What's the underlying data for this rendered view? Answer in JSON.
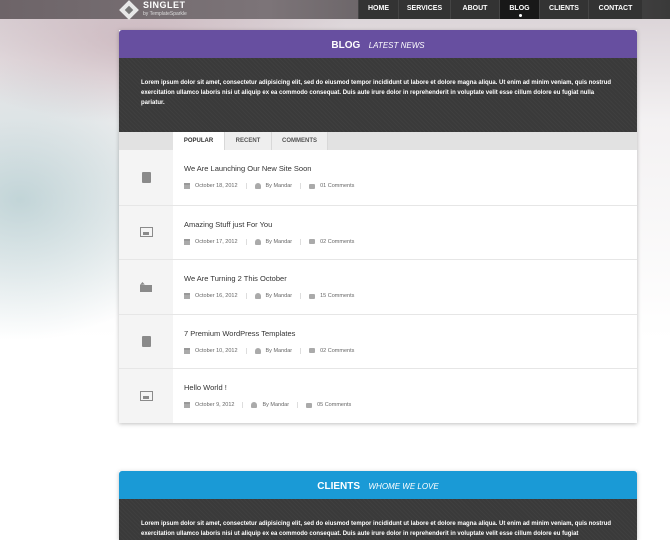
{
  "brand": {
    "name": "SINGLET",
    "tagline": "by TemplateSparkle"
  },
  "nav": [
    {
      "label": "HOME",
      "active": false
    },
    {
      "label": "SERVICES",
      "active": false
    },
    {
      "label": "ABOUT",
      "active": false
    },
    {
      "label": "BLOG",
      "active": true
    },
    {
      "label": "CLIENTS",
      "active": false
    },
    {
      "label": "CONTACT",
      "active": false
    }
  ],
  "blog": {
    "title": "BLOG",
    "subtitle": "LATEST NEWS",
    "intro": "Lorem ipsum dolor sit amet, consectetur adipisicing elit, sed do eiusmod tempor incididunt ut labore et dolore magna aliqua. Ut enim ad minim veniam, quis nostrud exercitation ullamco laboris nisi ut aliquip ex ea commodo consequat. Duis aute irure dolor in reprehenderit in voluptate velit esse cillum dolore eu fugiat nulla pariatur.",
    "accent": "#674fa0",
    "tabs": [
      {
        "label": "POPULAR",
        "active": true
      },
      {
        "label": "RECENT",
        "active": false
      },
      {
        "label": "COMMENTS",
        "active": false
      }
    ],
    "posts": [
      {
        "icon": "document-icon",
        "title": "We Are Launching Our New Site Soon",
        "date": "October 18, 2012",
        "author": "By Mandar",
        "comments": "01 Comments"
      },
      {
        "icon": "image-icon",
        "title": "Amazing Stuff just For You",
        "date": "October 17, 2012",
        "author": "By Mandar",
        "comments": "02 Comments"
      },
      {
        "icon": "video-icon",
        "title": "We Are Turning 2 This October",
        "date": "October 16, 2012",
        "author": "By Mandar",
        "comments": "15 Comments"
      },
      {
        "icon": "document-icon",
        "title": "7 Premium WordPress Templates",
        "date": "October 10, 2012",
        "author": "By Mandar",
        "comments": "02 Comments"
      },
      {
        "icon": "image-icon",
        "title": "Hello World !",
        "date": "October 9, 2012",
        "author": "By Mandar",
        "comments": "05 Comments"
      }
    ]
  },
  "clients": {
    "title": "CLIENTS",
    "subtitle": "WHOME WE LOVE",
    "intro": "Lorem ipsum dolor sit amet, consectetur adipisicing elit, sed do eiusmod tempor incididunt ut labore et dolore magna aliqua. Ut enim ad minim veniam, quis nostrud exercitation ullamco laboris nisi ut aliquip ex ea commodo consequat. Duis aute irure dolor in reprehenderit in voluptate velit esse cillum dolore eu fugiat",
    "accent": "#1a9ad6"
  }
}
